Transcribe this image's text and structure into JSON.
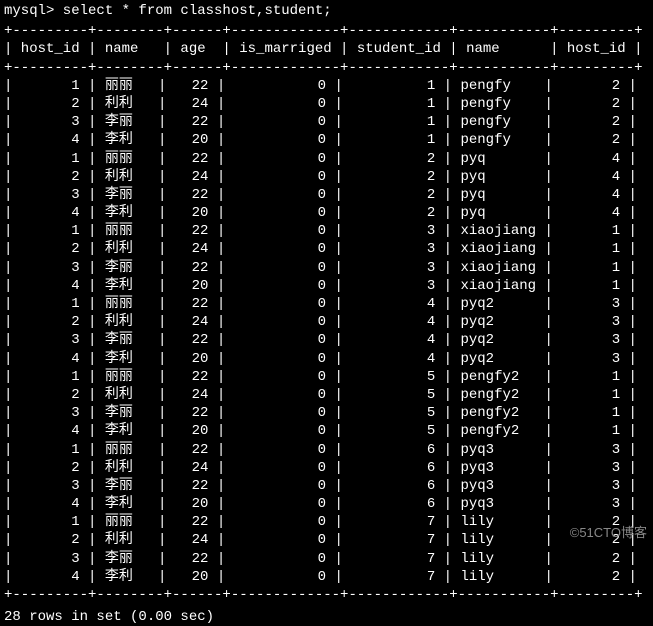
{
  "prompt": "mysql> select * from classhost,student;",
  "columns": [
    "host_id",
    "name",
    "age",
    "is_marriged",
    "student_id",
    "name",
    "host_id"
  ],
  "rows": [
    {
      "h1": "1",
      "n1": "丽丽",
      "age": "22",
      "im": "0",
      "sid": "1",
      "n2": "pengfy",
      "h2": "2"
    },
    {
      "h1": "2",
      "n1": "利利",
      "age": "24",
      "im": "0",
      "sid": "1",
      "n2": "pengfy",
      "h2": "2"
    },
    {
      "h1": "3",
      "n1": "李丽",
      "age": "22",
      "im": "0",
      "sid": "1",
      "n2": "pengfy",
      "h2": "2"
    },
    {
      "h1": "4",
      "n1": "李利",
      "age": "20",
      "im": "0",
      "sid": "1",
      "n2": "pengfy",
      "h2": "2"
    },
    {
      "h1": "1",
      "n1": "丽丽",
      "age": "22",
      "im": "0",
      "sid": "2",
      "n2": "pyq",
      "h2": "4"
    },
    {
      "h1": "2",
      "n1": "利利",
      "age": "24",
      "im": "0",
      "sid": "2",
      "n2": "pyq",
      "h2": "4"
    },
    {
      "h1": "3",
      "n1": "李丽",
      "age": "22",
      "im": "0",
      "sid": "2",
      "n2": "pyq",
      "h2": "4"
    },
    {
      "h1": "4",
      "n1": "李利",
      "age": "20",
      "im": "0",
      "sid": "2",
      "n2": "pyq",
      "h2": "4"
    },
    {
      "h1": "1",
      "n1": "丽丽",
      "age": "22",
      "im": "0",
      "sid": "3",
      "n2": "xiaojiang",
      "h2": "1"
    },
    {
      "h1": "2",
      "n1": "利利",
      "age": "24",
      "im": "0",
      "sid": "3",
      "n2": "xiaojiang",
      "h2": "1"
    },
    {
      "h1": "3",
      "n1": "李丽",
      "age": "22",
      "im": "0",
      "sid": "3",
      "n2": "xiaojiang",
      "h2": "1"
    },
    {
      "h1": "4",
      "n1": "李利",
      "age": "20",
      "im": "0",
      "sid": "3",
      "n2": "xiaojiang",
      "h2": "1"
    },
    {
      "h1": "1",
      "n1": "丽丽",
      "age": "22",
      "im": "0",
      "sid": "4",
      "n2": "pyq2",
      "h2": "3"
    },
    {
      "h1": "2",
      "n1": "利利",
      "age": "24",
      "im": "0",
      "sid": "4",
      "n2": "pyq2",
      "h2": "3"
    },
    {
      "h1": "3",
      "n1": "李丽",
      "age": "22",
      "im": "0",
      "sid": "4",
      "n2": "pyq2",
      "h2": "3"
    },
    {
      "h1": "4",
      "n1": "李利",
      "age": "20",
      "im": "0",
      "sid": "4",
      "n2": "pyq2",
      "h2": "3"
    },
    {
      "h1": "1",
      "n1": "丽丽",
      "age": "22",
      "im": "0",
      "sid": "5",
      "n2": "pengfy2",
      "h2": "1"
    },
    {
      "h1": "2",
      "n1": "利利",
      "age": "24",
      "im": "0",
      "sid": "5",
      "n2": "pengfy2",
      "h2": "1"
    },
    {
      "h1": "3",
      "n1": "李丽",
      "age": "22",
      "im": "0",
      "sid": "5",
      "n2": "pengfy2",
      "h2": "1"
    },
    {
      "h1": "4",
      "n1": "李利",
      "age": "20",
      "im": "0",
      "sid": "5",
      "n2": "pengfy2",
      "h2": "1"
    },
    {
      "h1": "1",
      "n1": "丽丽",
      "age": "22",
      "im": "0",
      "sid": "6",
      "n2": "pyq3",
      "h2": "3"
    },
    {
      "h1": "2",
      "n1": "利利",
      "age": "24",
      "im": "0",
      "sid": "6",
      "n2": "pyq3",
      "h2": "3"
    },
    {
      "h1": "3",
      "n1": "李丽",
      "age": "22",
      "im": "0",
      "sid": "6",
      "n2": "pyq3",
      "h2": "3"
    },
    {
      "h1": "4",
      "n1": "李利",
      "age": "20",
      "im": "0",
      "sid": "6",
      "n2": "pyq3",
      "h2": "3"
    },
    {
      "h1": "1",
      "n1": "丽丽",
      "age": "22",
      "im": "0",
      "sid": "7",
      "n2": "lily",
      "h2": "2"
    },
    {
      "h1": "2",
      "n1": "利利",
      "age": "24",
      "im": "0",
      "sid": "7",
      "n2": "lily",
      "h2": "2"
    },
    {
      "h1": "3",
      "n1": "李丽",
      "age": "22",
      "im": "0",
      "sid": "7",
      "n2": "lily",
      "h2": "2"
    },
    {
      "h1": "4",
      "n1": "李利",
      "age": "20",
      "im": "0",
      "sid": "7",
      "n2": "lily",
      "h2": "2"
    }
  ],
  "hrule": "+---------+--------+------+-------------+------------+-----------+---------+",
  "footer": "28 rows in set (0.00 sec)",
  "watermark": "©51CTO博客",
  "colwidths": {
    "h1": 7,
    "n1": 6,
    "age": 4,
    "im": 11,
    "sid": 10,
    "n2": 9,
    "h2": 7
  }
}
